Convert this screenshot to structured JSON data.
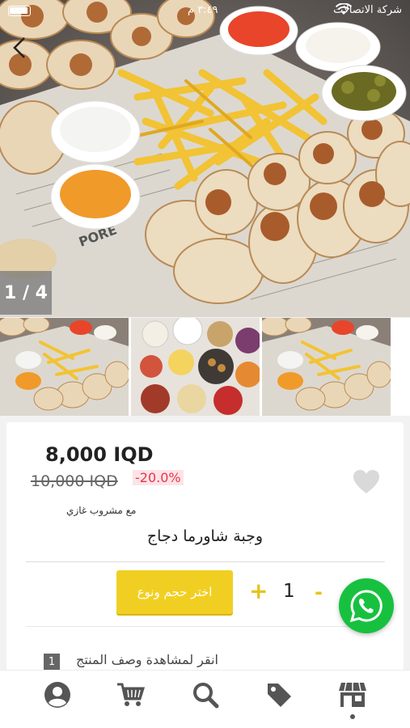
{
  "status_bar": {
    "carrier": "شركة الاتصالات",
    "time": "٣:٤٩ م"
  },
  "gallery": {
    "counter": "1 / 4",
    "current_index": 1,
    "total": 4,
    "thumbnails": [
      "shawarma-platter",
      "mezze-spread",
      "shawarma-platter"
    ]
  },
  "product": {
    "price": "8,000 IQD",
    "old_price": "10,000 IQD",
    "discount": "-20.0%",
    "subtitle": "مع مشروب غازي",
    "title": "وجبة شاورما دجاج",
    "favorite": false
  },
  "cart_controls": {
    "choose_label": "اختر حجم ونوع",
    "plus": "+",
    "quantity": "1",
    "minus": "-"
  },
  "description": {
    "badge": "1",
    "label": "انقر لمشاهدة وصف المنتج"
  },
  "bottom_nav": {
    "items": [
      "account-icon",
      "cart-icon",
      "search-icon",
      "offers-icon",
      "store-icon"
    ],
    "active": "store-icon"
  },
  "colors": {
    "accent": "#f1cf22",
    "discount": "#e8354c",
    "whatsapp": "#17c13f"
  }
}
